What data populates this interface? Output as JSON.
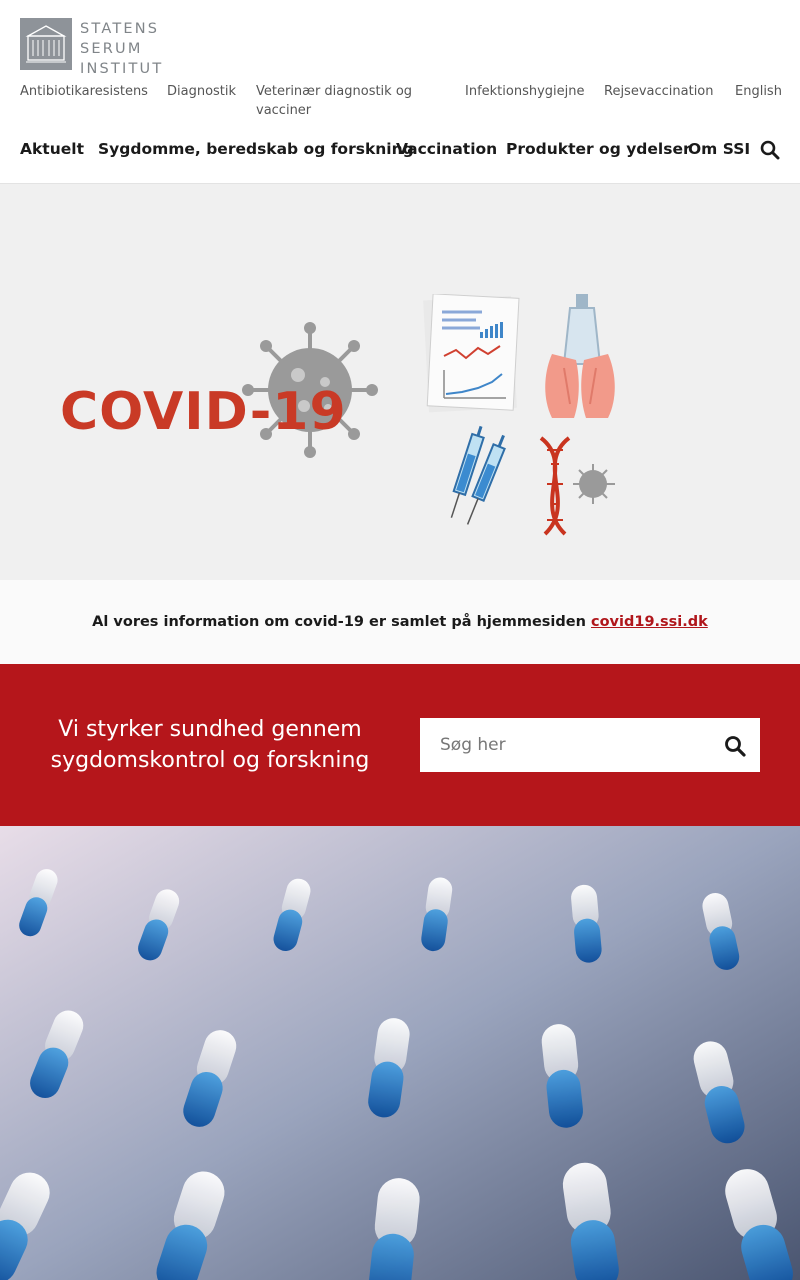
{
  "logo": {
    "lines": [
      "STATENS",
      "SERUM",
      "INSTITUT"
    ]
  },
  "utility_nav": [
    {
      "label": "Antibiotikaresistens"
    },
    {
      "label": "Diagnostik"
    },
    {
      "label": "Veterinær diagnostik og vacciner"
    },
    {
      "label": "Infektionshygiejne"
    },
    {
      "label": "Rejsevaccination"
    },
    {
      "label": "English"
    }
  ],
  "main_nav": [
    {
      "label": "Aktuelt"
    },
    {
      "label": "Sygdomme, beredskab og forskning"
    },
    {
      "label": "Vaccination"
    },
    {
      "label": "Produkter og ydelser"
    },
    {
      "label": "Om SSI"
    }
  ],
  "covid_hero": {
    "wordmark": "COVID-19"
  },
  "covid_banner": {
    "text": "Al vores information om covid-19 er samlet på hjemmesiden",
    "link_label": "covid19.ssi.dk"
  },
  "red_band": {
    "tagline": "Vi styrker sundhed gennem sygdomskontrol og forskning",
    "search_placeholder": "Søg her"
  },
  "colors": {
    "brand_red": "#b5161b",
    "covid_red": "#c93a26",
    "logo_gray": "#8e9399"
  }
}
